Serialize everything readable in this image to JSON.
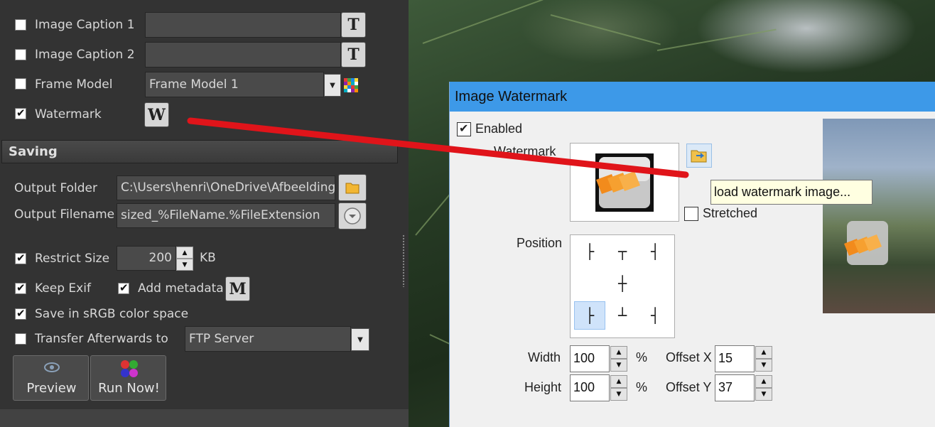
{
  "left_panel": {
    "options": [
      {
        "label": "Image Caption 1",
        "checked": false,
        "field_value": "",
        "button_icon": "T"
      },
      {
        "label": "Image Caption 2",
        "checked": false,
        "field_value": "",
        "button_icon": "T"
      },
      {
        "label": "Frame Model",
        "checked": false,
        "select_value": "Frame Model 1"
      },
      {
        "label": "Watermark",
        "checked": true,
        "button_icon": "W"
      }
    ],
    "saving": {
      "header": "Saving",
      "output_folder_label": "Output Folder",
      "output_folder_value": "C:\\Users\\henri\\OneDrive\\Afbeelding",
      "output_filename_label": "Output Filename",
      "output_filename_value": "sized_%FileName.%FileExtension",
      "restrict_size_label": "Restrict Size",
      "restrict_size_checked": true,
      "restrict_size_value": "200",
      "restrict_size_unit": "KB",
      "keep_exif_label": "Keep Exif",
      "keep_exif_checked": true,
      "add_metadata_label": "Add metadata",
      "add_metadata_checked": true,
      "metadata_button_icon": "M",
      "srgb_label": "Save in sRGB color space",
      "srgb_checked": true,
      "transfer_label": "Transfer Afterwards to",
      "transfer_checked": false,
      "transfer_value": "FTP Server",
      "preview_button": "Preview",
      "run_button": "Run Now!"
    }
  },
  "dialog": {
    "title": "Image Watermark",
    "enabled_label": "Enabled",
    "enabled_checked": true,
    "watermark_label": "Watermark",
    "tooltip": "load watermark image...",
    "stretched_label": "Stretched",
    "stretched_checked": false,
    "position_label": "Position",
    "position_selected": "bottom-left",
    "width_label": "Width",
    "width_value": "100",
    "width_unit": "%",
    "height_label": "Height",
    "height_value": "100",
    "height_unit": "%",
    "offset_x_label": "Offset X",
    "offset_x_value": "15",
    "offset_y_label": "Offset Y",
    "offset_y_value": "37"
  },
  "colors": {
    "panel_bg": "#333333",
    "dialog_title_bg": "#3d99e8",
    "annotation_line": "#e0141a",
    "tooltip_bg": "#ffffe1"
  }
}
